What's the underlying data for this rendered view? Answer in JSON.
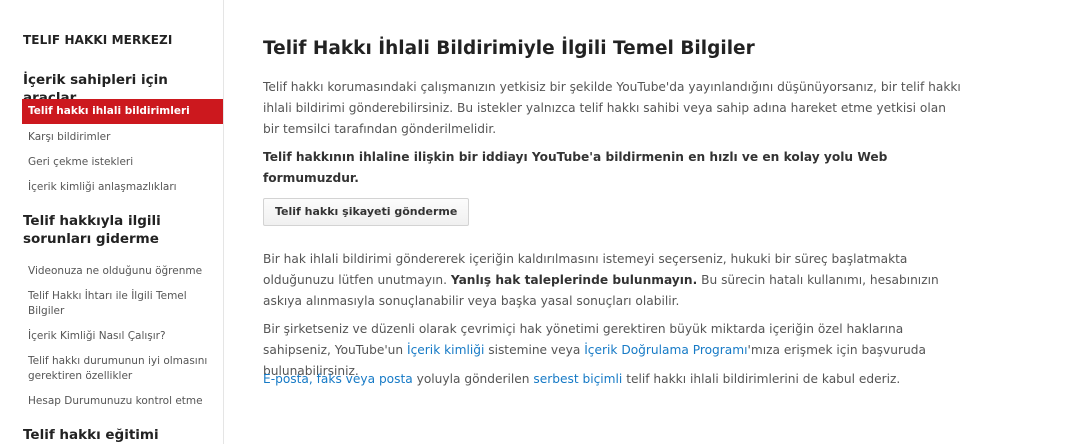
{
  "sidebar": {
    "brand": "TELIF HAKKI MERKEZI",
    "section1": {
      "title": "İçerik sahipleri için araçlar",
      "items": [
        "Telif hakkı ihlali bildirimleri",
        "Karşı bildirimler",
        "Geri çekme istekleri",
        "İçerik kimliği anlaşmazlıkları"
      ]
    },
    "section2": {
      "title": "Telif hakkıyla ilgili sorunları giderme",
      "items": [
        "Videonuza ne olduğunu öğrenme",
        "Telif Hakkı İhtarı ile İlgili Temel Bilgiler",
        "İçerik Kimliği Nasıl Çalışır?",
        "Telif hakkı durumunun iyi olmasını gerektiren özellikler",
        "Hesap Durumunuzu kontrol etme"
      ]
    },
    "section3": {
      "title": "Telif hakkı eğitimi"
    }
  },
  "main": {
    "title": "Telif Hakkı İhlali Bildirimiyle İlgili Temel Bilgiler",
    "p1": "Telif hakkı korumasındaki çalışmanızın yetkisiz bir şekilde YouTube'da yayınlandığını düşünüyorsanız, bir telif hakkı ihlali bildirimi gönderebilirsiniz. Bu istekler yalnızca telif hakkı sahibi veya sahip adına hareket etme yetkisi olan bir temsilci tarafından gönderilmelidir.",
    "p2": "Telif hakkının ihlaline ilişkin bir iddiayı YouTube'a bildirmenin en hızlı ve en kolay yolu Web formumuzdur.",
    "button_label": "Telif hakkı şikayeti gönderme",
    "p3": {
      "part1": "Bir hak ihlali bildirimi göndererek içeriğin kaldırılmasını istemeyi seçerseniz, hukuki bir süreç başlatmakta olduğunuzu lütfen unutmayın. ",
      "bold": "Yanlış hak taleplerinde bulunmayın.",
      "part2": " Bu sürecin hatalı kullanımı, hesabınızın askıya alınmasıyla sonuçlanabilir veya başka yasal sonuçları olabilir."
    },
    "p4": {
      "part1": "Bir şirketseniz ve düzenli olarak çevrimiçi hak yönetimi gerektiren büyük miktarda içeriğin özel haklarına sahipseniz, YouTube'un ",
      "link1": "İçerik kimliği",
      "part2": " sistemine veya ",
      "link2": "İçerik Doğrulama Programı",
      "part3": "'mıza erişmek için başvuruda bulunabilirsiniz."
    },
    "p5": {
      "link1": "E-posta, faks veya posta",
      "part1": " yoluyla gönderilen ",
      "link2": "serbest biçimli",
      "part2": " telif hakkı ihlali bildirimlerini de kabul ederiz."
    }
  }
}
